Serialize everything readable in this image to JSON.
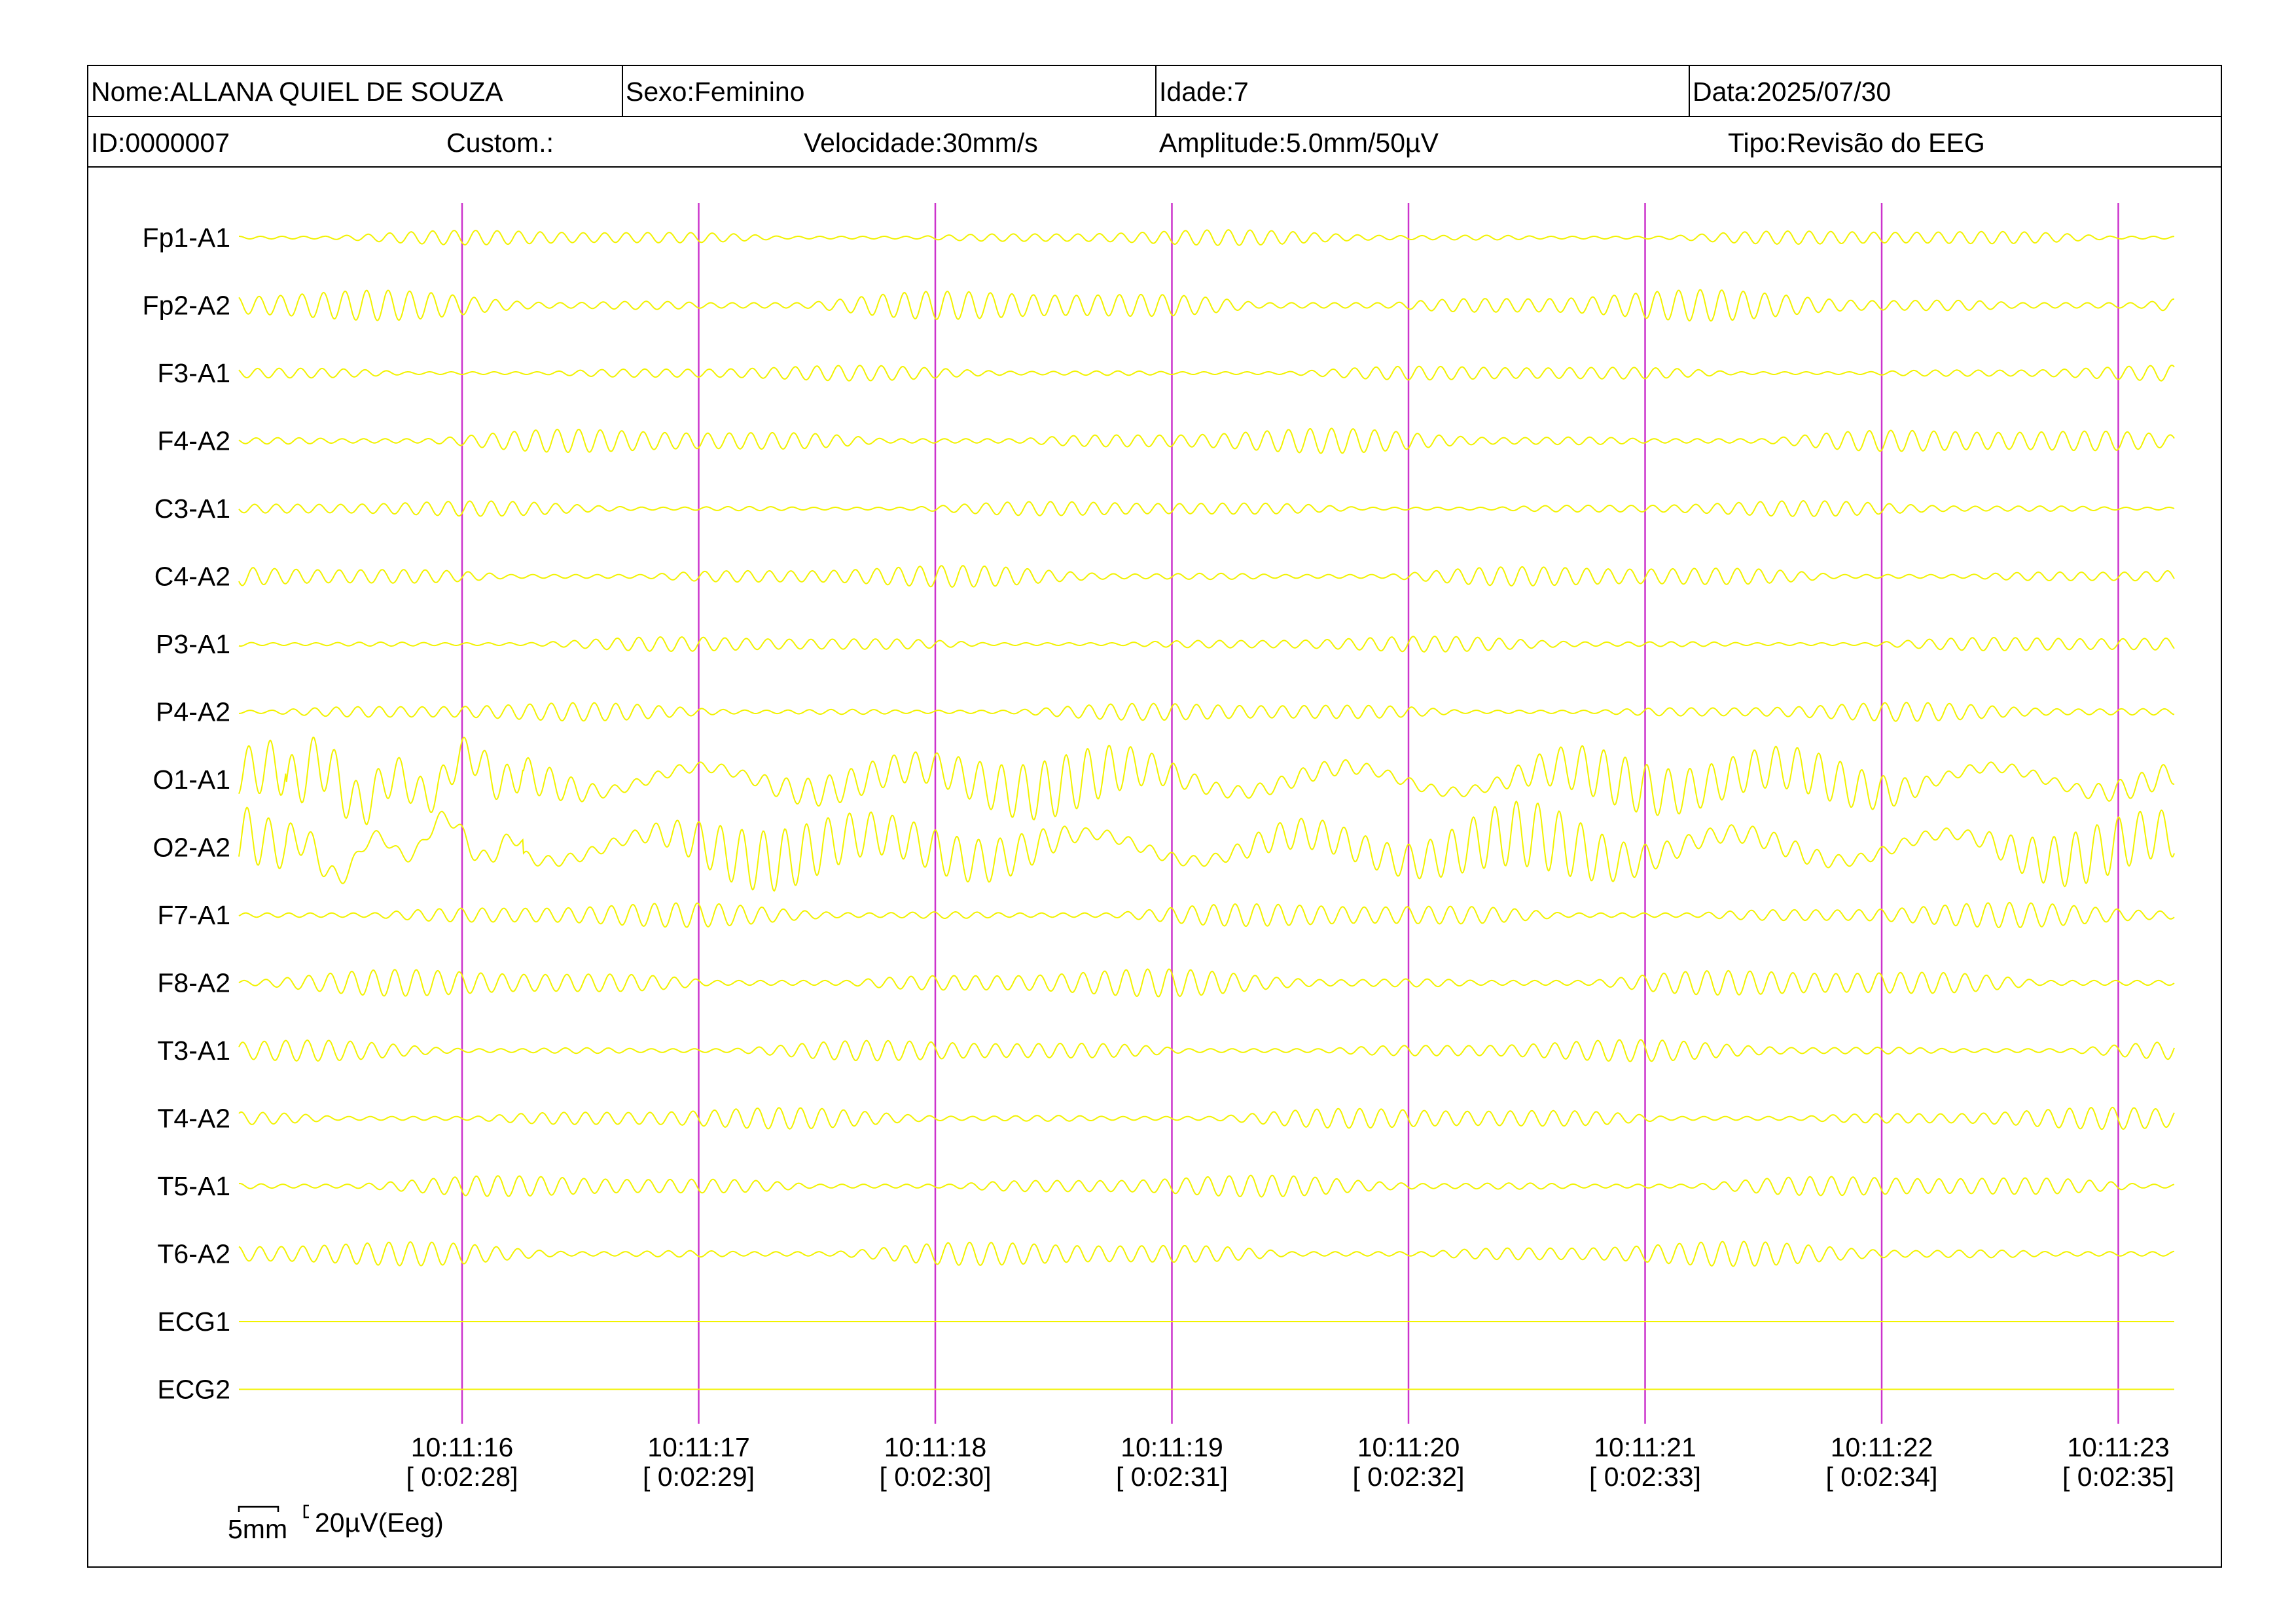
{
  "header": {
    "nome": "Nome:ALLANA QUIEL DE SOUZA",
    "sexo": "Sexo:Feminino",
    "idade": "Idade:7",
    "data": "Data:2025/07/30",
    "id": "ID:0000007",
    "custom": "Custom.:",
    "velocidade": "Velocidade:30mm/s",
    "amplitude": "Amplitude:5.0mm/50µV",
    "tipo": "Tipo:Revisão do EEG"
  },
  "scale": {
    "time_label": "5mm",
    "amp_label": "20µV(Eeg)"
  },
  "colors": {
    "trace": "#f2f200",
    "marker": "#cc33cc",
    "frame": "#000000"
  },
  "chart_data": {
    "type": "line",
    "channels": [
      "Fp1-A1",
      "Fp2-A2",
      "F3-A1",
      "F4-A2",
      "C3-A1",
      "C4-A2",
      "P3-A1",
      "P4-A2",
      "O1-A1",
      "O2-A2",
      "F7-A1",
      "F8-A2",
      "T3-A1",
      "T4-A2",
      "T5-A1",
      "T6-A2",
      "ECG1",
      "ECG2"
    ],
    "time_markers": [
      {
        "clock": "10:11:16",
        "elapsed": "[ 0:02:28]"
      },
      {
        "clock": "10:11:17",
        "elapsed": "[ 0:02:29]"
      },
      {
        "clock": "10:11:18",
        "elapsed": "[ 0:02:30]"
      },
      {
        "clock": "10:11:19",
        "elapsed": "[ 0:02:31]"
      },
      {
        "clock": "10:11:20",
        "elapsed": "[ 0:02:32]"
      },
      {
        "clock": "10:11:21",
        "elapsed": "[ 0:02:33]"
      },
      {
        "clock": "10:11:22",
        "elapsed": "[ 0:02:34]"
      },
      {
        "clock": "10:11:23",
        "elapsed": "[ 0:02:35]"
      }
    ],
    "page_seconds": 8.2,
    "dominant_frequency_hz": 11
  }
}
